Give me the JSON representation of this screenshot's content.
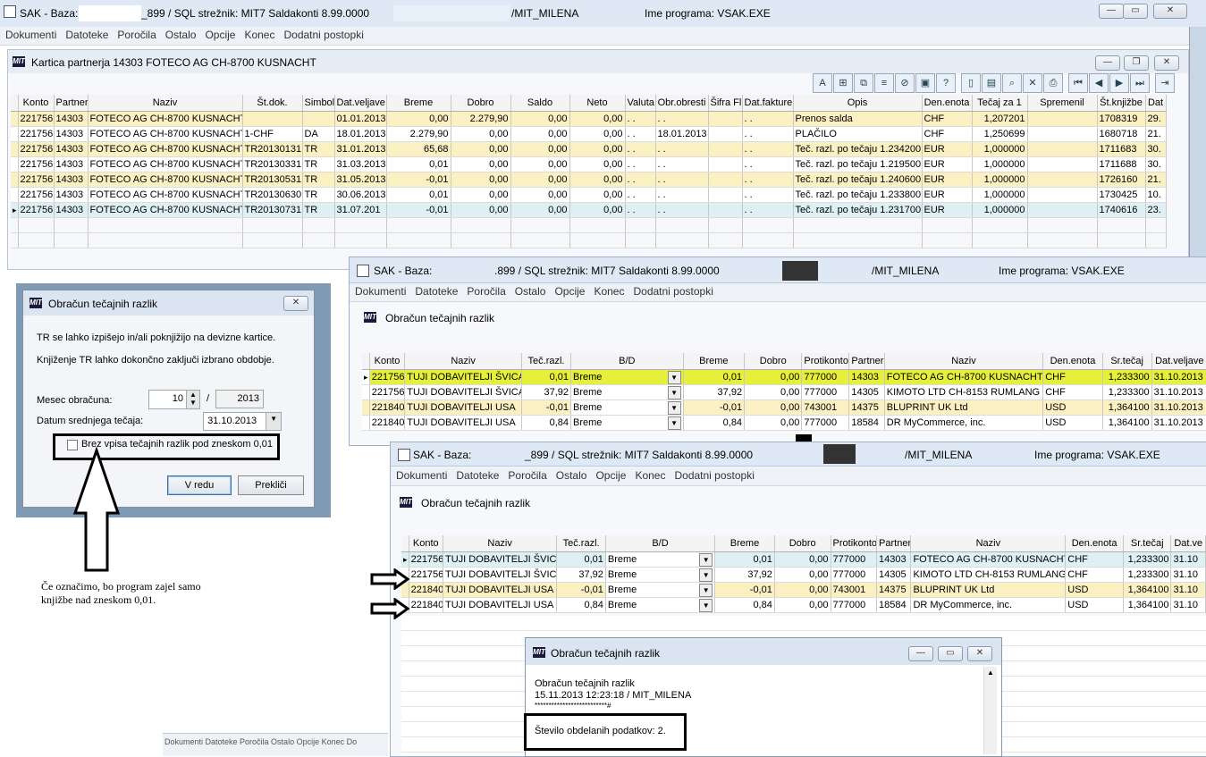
{
  "main_window": {
    "title_left": "SAK - Baza: F",
    "title_mid": "_899 / SQL strežnik: MIT7   Saldakonti 8.99.0000",
    "title_user": "/MIT_MILENA",
    "title_program": "Ime programa: VSAK.EXE",
    "menu": [
      "Dokumenti",
      "Datoteke",
      "Poročila",
      "Ostalo",
      "Opcije",
      "Konec",
      "Dodatni postopki"
    ]
  },
  "card_window": {
    "title": "Kartica partnerja 14303   FOTECO AG CH-8700 KUSNACHT",
    "columns": [
      "Konto",
      "Partner",
      "Naziv",
      "Št.dok.",
      "Simbol",
      "Dat.veljave",
      "Breme",
      "Dobro",
      "Saldo",
      "Neto",
      "Valuta",
      "Obr.obresti",
      "Šifra Fl",
      "Dat.fakture",
      "Opis",
      "Den.enota",
      "Tečaj za 1",
      "Spremenil",
      "Št.knjižbe",
      "Dat"
    ],
    "rows": [
      {
        "style": "Y",
        "cells": [
          "221756",
          "14303",
          "FOTECO AG CH-8700 KUSNACHT",
          "",
          "",
          "01.01.2013",
          "0,00",
          "2.279,90",
          "0,00",
          "0,00",
          ". .",
          ". .",
          "",
          ". .",
          "Prenos salda",
          "CHF",
          "1,207201",
          "",
          "1708319",
          "29."
        ]
      },
      {
        "style": "W",
        "cells": [
          "221756",
          "14303",
          "FOTECO AG CH-8700 KUSNACHT",
          "1-CHF",
          "DA",
          "18.01.2013",
          "2.279,90",
          "0,00",
          "0,00",
          "0,00",
          ". .",
          "18.01.2013",
          "",
          ". .",
          "PLAČILO",
          "CHF",
          "1,250699",
          "",
          "1680718",
          "21."
        ]
      },
      {
        "style": "Y",
        "cells": [
          "221756",
          "14303",
          "FOTECO AG CH-8700 KUSNACHT",
          "TR20130131",
          "TR",
          "31.01.2013",
          "65,68",
          "0,00",
          "0,00",
          "0,00",
          ". .",
          ". .",
          "",
          ". .",
          "Teč. razl. po tečaju 1.234200",
          "EUR",
          "1,000000",
          "",
          "1711683",
          "30."
        ]
      },
      {
        "style": "W",
        "cells": [
          "221756",
          "14303",
          "FOTECO AG CH-8700 KUSNACHT",
          "TR20130331",
          "TR",
          "31.03.2013",
          "0,01",
          "0,00",
          "0,00",
          "0,00",
          ". .",
          ". .",
          "",
          ". .",
          "Teč. razl. po tečaju 1.219500",
          "EUR",
          "1,000000",
          "",
          "1711688",
          "30."
        ]
      },
      {
        "style": "Y",
        "cells": [
          "221756",
          "14303",
          "FOTECO AG CH-8700 KUSNACHT",
          "TR20130531",
          "TR",
          "31.05.2013",
          "-0,01",
          "0,00",
          "0,00",
          "0,00",
          ". .",
          ". .",
          "",
          ". .",
          "Teč. razl. po tečaju 1.240600",
          "EUR",
          "1,000000",
          "",
          "1726160",
          "21."
        ]
      },
      {
        "style": "W",
        "cells": [
          "221756",
          "14303",
          "FOTECO AG CH-8700 KUSNACHT",
          "TR20130630",
          "TR",
          "30.06.2013",
          "0,01",
          "0,00",
          "0,00",
          "0,00",
          ". .",
          ". .",
          "",
          ". .",
          "Teč. razl. po tečaju 1.233800",
          "EUR",
          "1,000000",
          "",
          "1730425",
          "10."
        ]
      },
      {
        "style": "S",
        "cells": [
          "221756",
          "14303",
          "FOTECO AG CH-8700 KUSNACHT",
          "TR20130731",
          "TR",
          "31.07.201",
          "-0,01",
          "0,00",
          "0,00",
          "0,00",
          ". .",
          ". .",
          "",
          ". .",
          "Teč. razl. po tečaju 1.231700",
          "EUR",
          "1,000000",
          "",
          "1740616",
          "23."
        ]
      }
    ]
  },
  "dialog_left": {
    "title": "Obračun tečajnih razlik",
    "line1": "TR se lahko izpišejo in/ali poknjižijo na devizne kartice.",
    "line2": "Knjiženje TR lahko dokončno zaključi izbrano obdobje.",
    "month_label": "Mesec obračuna:",
    "month_value": "10",
    "slash": "/",
    "year_value": "2013",
    "date_label": "Datum srednjega tečaja:",
    "date_value": "31.10.2013",
    "checkbox_label": "Brez vpisa tečajnih razlik pod zneskom 0,01",
    "ok_label": "V redu",
    "cancel_label": "Prekliči"
  },
  "annotation": {
    "text1": "Če označimo, bo program zajel samo",
    "text2": "knjižbe nad zneskom 0,01."
  },
  "window2": {
    "title_left": "SAK - Baza:",
    "title_mid": ".899 / SQL strežnik: MIT7   Saldakonti 8.99.0000",
    "title_user": "/MIT_MILENA",
    "title_program": "Ime programa: VSAK.EXE",
    "menu": [
      "Dokumenti",
      "Datoteke",
      "Poročila",
      "Ostalo",
      "Opcije",
      "Konec",
      "Dodatni postopki"
    ],
    "inner_title": "Obračun tečajnih razlik",
    "columns": [
      "Konto",
      "Naziv",
      "Teč.razl.",
      "B/D",
      "Breme",
      "Dobro",
      "Protikonto",
      "Partner",
      "Naziv",
      "Den.enota",
      "Sr.tečaj",
      "Dat.veljave"
    ],
    "rows": [
      {
        "style": "H",
        "cells": [
          "221756",
          "TUJI DOBAVITELJI ŠVICA",
          "0,01",
          "Breme",
          "0,01",
          "0,00",
          "777000",
          "14303",
          "FOTECO AG CH-8700 KUSNACHT",
          "CHF",
          "1,233300",
          "31.10.2013"
        ]
      },
      {
        "style": "W",
        "cells": [
          "221756",
          "TUJI DOBAVITELJI ŠVICA",
          "37,92",
          "Breme",
          "37,92",
          "0,00",
          "777000",
          "14305",
          "KIMOTO LTD CH-8153 RUMLANG",
          "CHF",
          "1,233300",
          "31.10.2013"
        ]
      },
      {
        "style": "Y",
        "cells": [
          "221840",
          "TUJI DOBAVITELJI USA",
          "-0,01",
          "Breme",
          "-0,01",
          "0,00",
          "743001",
          "14375",
          "BLUPRINT UK Ltd",
          "USD",
          "1,364100",
          "31.10.2013"
        ]
      },
      {
        "style": "W",
        "cells": [
          "221840",
          "TUJI DOBAVITELJI USA",
          "0,84",
          "Breme",
          "0,84",
          "0,00",
          "777000",
          "18584",
          "DR MyCommerce, inc.",
          "USD",
          "1,364100",
          "31.10.2013"
        ]
      }
    ]
  },
  "window3": {
    "title_left": "SAK - Baza:",
    "title_mid": "_899 / SQL strežnik: MIT7   Saldakonti 8.99.0000",
    "title_user": "/MIT_MILENA",
    "title_program": "Ime programa: VSAK.EXE",
    "menu": [
      "Dokumenti",
      "Datoteke",
      "Poročila",
      "Ostalo",
      "Opcije",
      "Konec",
      "Dodatni postopki"
    ],
    "inner_title": "Obračun tečajnih razlik",
    "columns": [
      "Konto",
      "Naziv",
      "Teč.razl.",
      "B/D",
      "Breme",
      "Dobro",
      "Protikonto",
      "Partner",
      "Naziv",
      "Den.enota",
      "Sr.tečaj",
      "Dat.ve"
    ],
    "rows": [
      {
        "style": "S",
        "cells": [
          "221756",
          "TUJI DOBAVITELJI ŠVICA",
          "0,01",
          "Breme",
          "0,01",
          "0,00",
          "777000",
          "14303",
          "FOTECO AG CH-8700 KUSNACHT",
          "CHF",
          "1,233300",
          "31.10"
        ]
      },
      {
        "style": "W",
        "cells": [
          "221756",
          "TUJI DOBAVITELJI ŠVICA",
          "37,92",
          "Breme",
          "37,92",
          "0,00",
          "777000",
          "14305",
          "KIMOTO LTD CH-8153 RUMLANG",
          "CHF",
          "1,233300",
          "31.10"
        ]
      },
      {
        "style": "Y",
        "cells": [
          "221840",
          "TUJI DOBAVITELJI USA",
          "-0,01",
          "Breme",
          "-0,01",
          "0,00",
          "743001",
          "14375",
          "BLUPRINT UK Ltd",
          "USD",
          "1,364100",
          "31.10"
        ]
      },
      {
        "style": "W",
        "cells": [
          "221840",
          "TUJI DOBAVITELJI USA",
          "0,84",
          "Breme",
          "0,84",
          "0,00",
          "777000",
          "18584",
          "DR MyCommerce, inc.",
          "USD",
          "1,364100",
          "31.10"
        ]
      }
    ]
  },
  "report_dialog": {
    "title": "Obračun tečajnih razlik",
    "line1": "Obračun tečajnih razlik",
    "line2": "15.11.2013 12:23:18 / MIT_MILENA",
    "line3": "**************************#",
    "result": "Število obdelanih podatkov: 2."
  },
  "bg_menu_fragment": "Dokumenti  Datoteke  Poročila  Ostalo  Opcije  Konec  Do"
}
